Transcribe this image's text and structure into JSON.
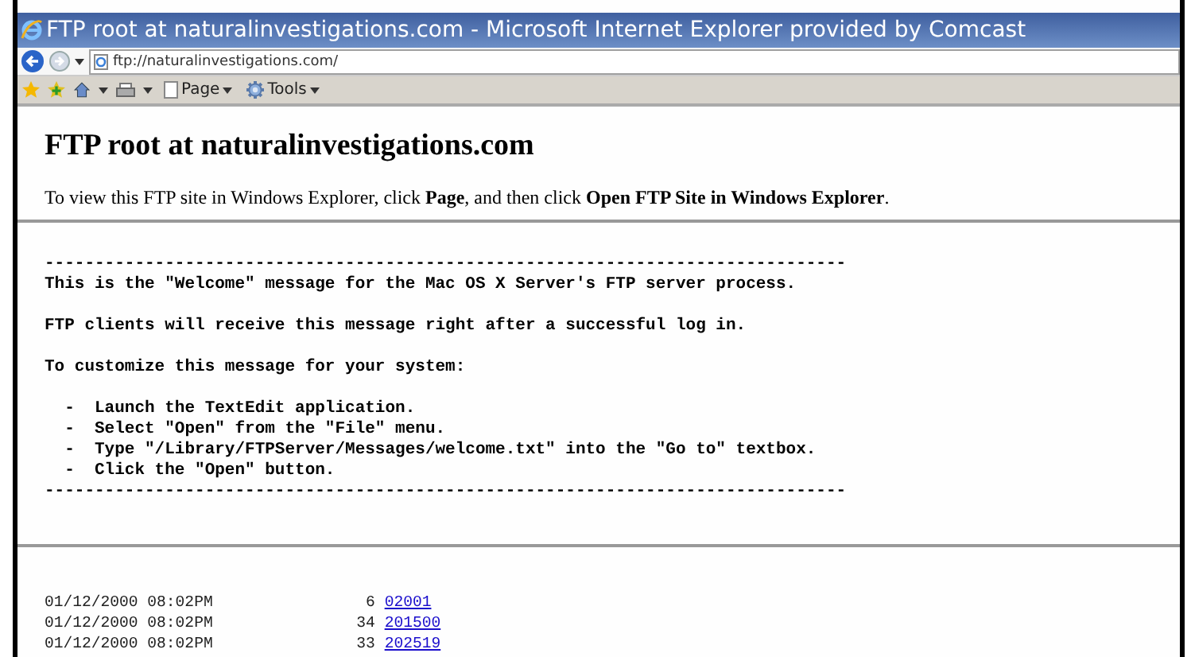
{
  "window": {
    "title": "FTP root at naturalinvestigations.com - Microsoft Internet Explorer provided by Comcast"
  },
  "address_bar": {
    "value": "ftp://naturalinvestigations.com/"
  },
  "toolbar": {
    "buttons": [
      {
        "label": "Page"
      },
      {
        "label": "Tools"
      }
    ]
  },
  "page": {
    "heading": "FTP root at naturalinvestigations.com",
    "intro": "To view this FTP site in Windows Explorer, click **Page**, and then click **Open FTP Site in Windows Explorer**.",
    "message": {
      "rule_top": "--------------------------------------------------------------------------------",
      "paragraphs": [
        "This is the \"Welcome\" message for the Mac OS X Server's FTP server process.",
        "FTP clients will receive this message right after a successful log in.",
        "To customize this message for your system:"
      ],
      "steps": [
        "-  Launch the TextEdit application.",
        "-  Select \"Open\" from the \"File\" menu.",
        "-  Type \"/Library/FTPServer/Messages/welcome.txt\" into the \"Go to\" textbox.",
        "-  Click the \"Open\" button."
      ],
      "rule_bottom": "--------------------------------------------------------------------------------"
    },
    "listing": [
      {
        "date": "01/12/2000 08:02PM",
        "size": "6",
        "name": "02001"
      },
      {
        "date": "01/12/2000 08:02PM",
        "size": "34",
        "name": "201500"
      },
      {
        "date": "01/12/2000 08:02PM",
        "size": "33",
        "name": "202519"
      }
    ]
  }
}
